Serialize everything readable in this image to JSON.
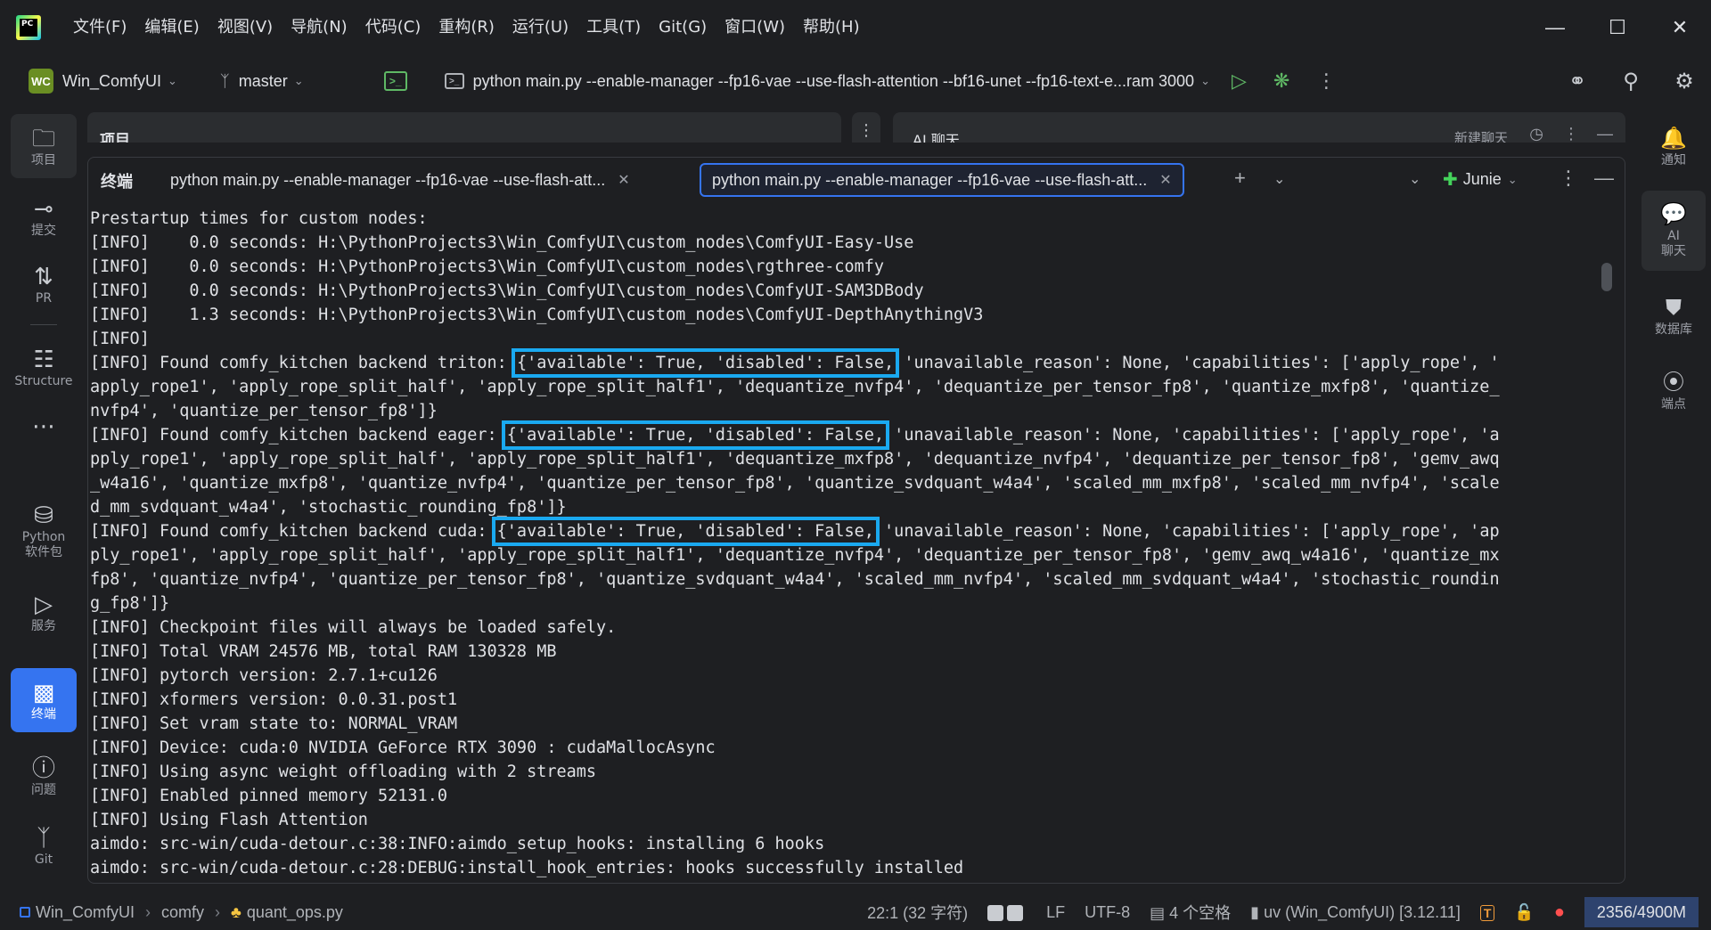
{
  "app": {
    "logo_text": "PC",
    "menu": [
      "文件(F)",
      "编辑(E)",
      "视图(V)",
      "导航(N)",
      "代码(C)",
      "重构(R)",
      "运行(U)",
      "工具(T)",
      "Git(G)",
      "窗口(W)",
      "帮助(H)"
    ]
  },
  "toolbar": {
    "project_badge": "WC",
    "project_name": "Win_ComfyUI",
    "branch": "master",
    "run_config": "python main.py --enable-manager --fp16-vae --use-flash-attention --bf16-unet --fp16-text-e...ram 3000"
  },
  "left_strip": [
    {
      "name": "project",
      "label": "项目",
      "icon": "folder-icon"
    },
    {
      "name": "commit",
      "label": "提交",
      "icon": "commit-icon"
    },
    {
      "name": "pr",
      "label": "PR",
      "icon": "pull-request-icon"
    },
    {
      "name": "structure",
      "label": "Structure",
      "icon": "structure-icon"
    },
    {
      "name": "python-packages",
      "label": "Python\n软件包",
      "icon": "python-packages-icon"
    },
    {
      "name": "services",
      "label": "服务",
      "icon": "services-icon"
    },
    {
      "name": "terminal",
      "label": "终端",
      "icon": "terminal-icon"
    },
    {
      "name": "problems",
      "label": "问题",
      "icon": "problems-icon"
    },
    {
      "name": "git",
      "label": "Git",
      "icon": "git-icon"
    }
  ],
  "right_strip": [
    {
      "name": "notifications",
      "label": "通知",
      "icon": "bell-icon"
    },
    {
      "name": "ai-chat",
      "label": "AI\n聊天",
      "icon": "ai-chat-icon"
    },
    {
      "name": "database",
      "label": "数据库",
      "icon": "database-icon"
    },
    {
      "name": "endpoints",
      "label": "端点",
      "icon": "endpoints-icon"
    }
  ],
  "behind_panels": {
    "project_title": "项目",
    "ai_title": "AI 聊天",
    "new_chat": "新建聊天"
  },
  "terminal": {
    "title": "终端",
    "tabs": [
      {
        "label": "python main.py --enable-manager --fp16-vae --use-flash-att...",
        "active": false
      },
      {
        "label": "python main.py --enable-manager --fp16-vae --use-flash-att...",
        "active": true
      }
    ],
    "junie": "Junie",
    "lines": [
      {
        "text": "Prestartup times for custom nodes:"
      },
      {
        "text": "[INFO]    0.0 seconds: H:\\PythonProjects3\\Win_ComfyUI\\custom_nodes\\ComfyUI-Easy-Use"
      },
      {
        "text": "[INFO]    0.0 seconds: H:\\PythonProjects3\\Win_ComfyUI\\custom_nodes\\rgthree-comfy"
      },
      {
        "text": "[INFO]    0.0 seconds: H:\\PythonProjects3\\Win_ComfyUI\\custom_nodes\\ComfyUI-SAM3DBody"
      },
      {
        "text": "[INFO]    1.3 seconds: H:\\PythonProjects3\\Win_ComfyUI\\custom_nodes\\ComfyUI-DepthAnythingV3"
      },
      {
        "text": "[INFO]"
      },
      {
        "pre": "[INFO] Found comfy_kitchen backend triton: ",
        "hl": "{'available': True, 'disabled': False,",
        "post": " 'unavailable_reason': None, 'capabilities': ['apply_rope', '"
      },
      {
        "text": "apply_rope1', 'apply_rope_split_half', 'apply_rope_split_half1', 'dequantize_nvfp4', 'dequantize_per_tensor_fp8', 'quantize_mxfp8', 'quantize_"
      },
      {
        "text": "nvfp4', 'quantize_per_tensor_fp8']}"
      },
      {
        "pre": "[INFO] Found comfy_kitchen backend eager: ",
        "hl": "{'available': True, 'disabled': False,",
        "post": " 'unavailable_reason': None, 'capabilities': ['apply_rope', 'a"
      },
      {
        "text": "pply_rope1', 'apply_rope_split_half', 'apply_rope_split_half1', 'dequantize_mxfp8', 'dequantize_nvfp4', 'dequantize_per_tensor_fp8', 'gemv_awq"
      },
      {
        "text": "_w4a16', 'quantize_mxfp8', 'quantize_nvfp4', 'quantize_per_tensor_fp8', 'quantize_svdquant_w4a4', 'scaled_mm_mxfp8', 'scaled_mm_nvfp4', 'scale"
      },
      {
        "text": "d_mm_svdquant_w4a4', 'stochastic_rounding_fp8']}"
      },
      {
        "pre": "[INFO] Found comfy_kitchen backend cuda: ",
        "hl": "{'available': True, 'disabled': False,",
        "post": " 'unavailable_reason': None, 'capabilities': ['apply_rope', 'ap"
      },
      {
        "text": "ply_rope1', 'apply_rope_split_half', 'apply_rope_split_half1', 'dequantize_nvfp4', 'dequantize_per_tensor_fp8', 'gemv_awq_w4a16', 'quantize_mx"
      },
      {
        "text": "fp8', 'quantize_nvfp4', 'quantize_per_tensor_fp8', 'quantize_svdquant_w4a4', 'scaled_mm_nvfp4', 'scaled_mm_svdquant_w4a4', 'stochastic_roundin"
      },
      {
        "text": "g_fp8']}"
      },
      {
        "text": "[INFO] Checkpoint files will always be loaded safely."
      },
      {
        "text": "[INFO] Total VRAM 24576 MB, total RAM 130328 MB"
      },
      {
        "text": "[INFO] pytorch version: 2.7.1+cu126"
      },
      {
        "text": "[INFO] xformers version: 0.0.31.post1"
      },
      {
        "text": "[INFO] Set vram state to: NORMAL_VRAM"
      },
      {
        "text": "[INFO] Device: cuda:0 NVIDIA GeForce RTX 3090 : cudaMallocAsync"
      },
      {
        "text": "[INFO] Using async weight offloading with 2 streams"
      },
      {
        "text": "[INFO] Enabled pinned memory 52131.0"
      },
      {
        "text": "[INFO] Using Flash Attention"
      },
      {
        "text": "aimdo: src-win/cuda-detour.c:38:INFO:aimdo_setup_hooks: installing 6 hooks"
      },
      {
        "text": "aimdo: src-win/cuda-detour.c:28:DEBUG:install_hook_entries: hooks successfully installed"
      }
    ]
  },
  "statusbar": {
    "crumbs": [
      "Win_ComfyUI",
      "comfy",
      "quant_ops.py"
    ],
    "position": "22:1 (32 字符)",
    "line_sep": "LF",
    "encoding": "UTF-8",
    "indent": "4 个空格",
    "interpreter": "uv (Win_ComfyUI) [3.12.11]",
    "t_badge": "T",
    "memory": "2356/4900M"
  },
  "colors": {
    "accent": "#3574f0",
    "highlight_box": "#1aa9f0",
    "bg": "#1e1f22",
    "panel": "#2b2d30"
  }
}
